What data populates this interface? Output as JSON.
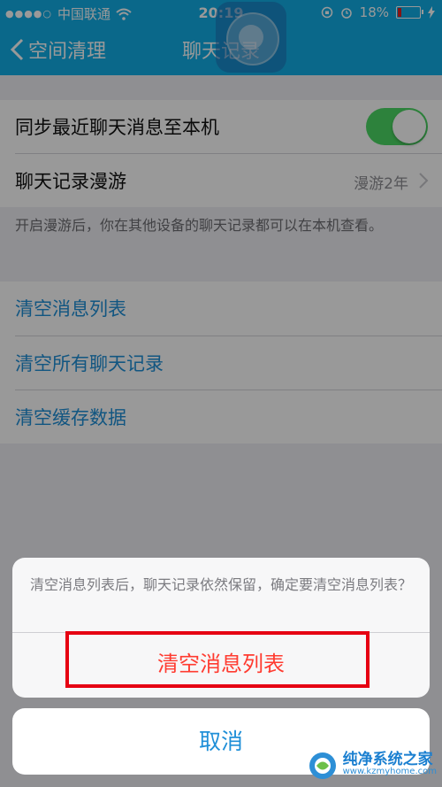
{
  "status_bar": {
    "carrier": "中国联通",
    "time": "20:19",
    "battery": "18%",
    "battery_level": 0.18
  },
  "nav": {
    "back_label": "空间清理",
    "title": "聊天记录"
  },
  "settings": {
    "sync_label": "同步最近聊天消息至本机",
    "sync_on": true,
    "roaming_label": "聊天记录漫游",
    "roaming_value": "漫游2年",
    "roaming_note": "开启漫游后，你在其他设备的聊天记录都可以在本机查看。",
    "actions": [
      "清空消息列表",
      "清空所有聊天记录",
      "清空缓存数据"
    ]
  },
  "action_sheet": {
    "message": "清空消息列表后，聊天记录依然保留，确定要清空消息列表？",
    "confirm_label": "清空消息列表",
    "cancel_label": "取消"
  },
  "watermark": {
    "title": "纯净系统之家",
    "url": "www.kzmyhome.com"
  },
  "colors": {
    "nav_bg": "#12aee6",
    "toggle_on": "#4cd964",
    "link_blue": "#1f8fd8",
    "destructive": "#ff3b30",
    "highlight_box": "#e60012"
  }
}
